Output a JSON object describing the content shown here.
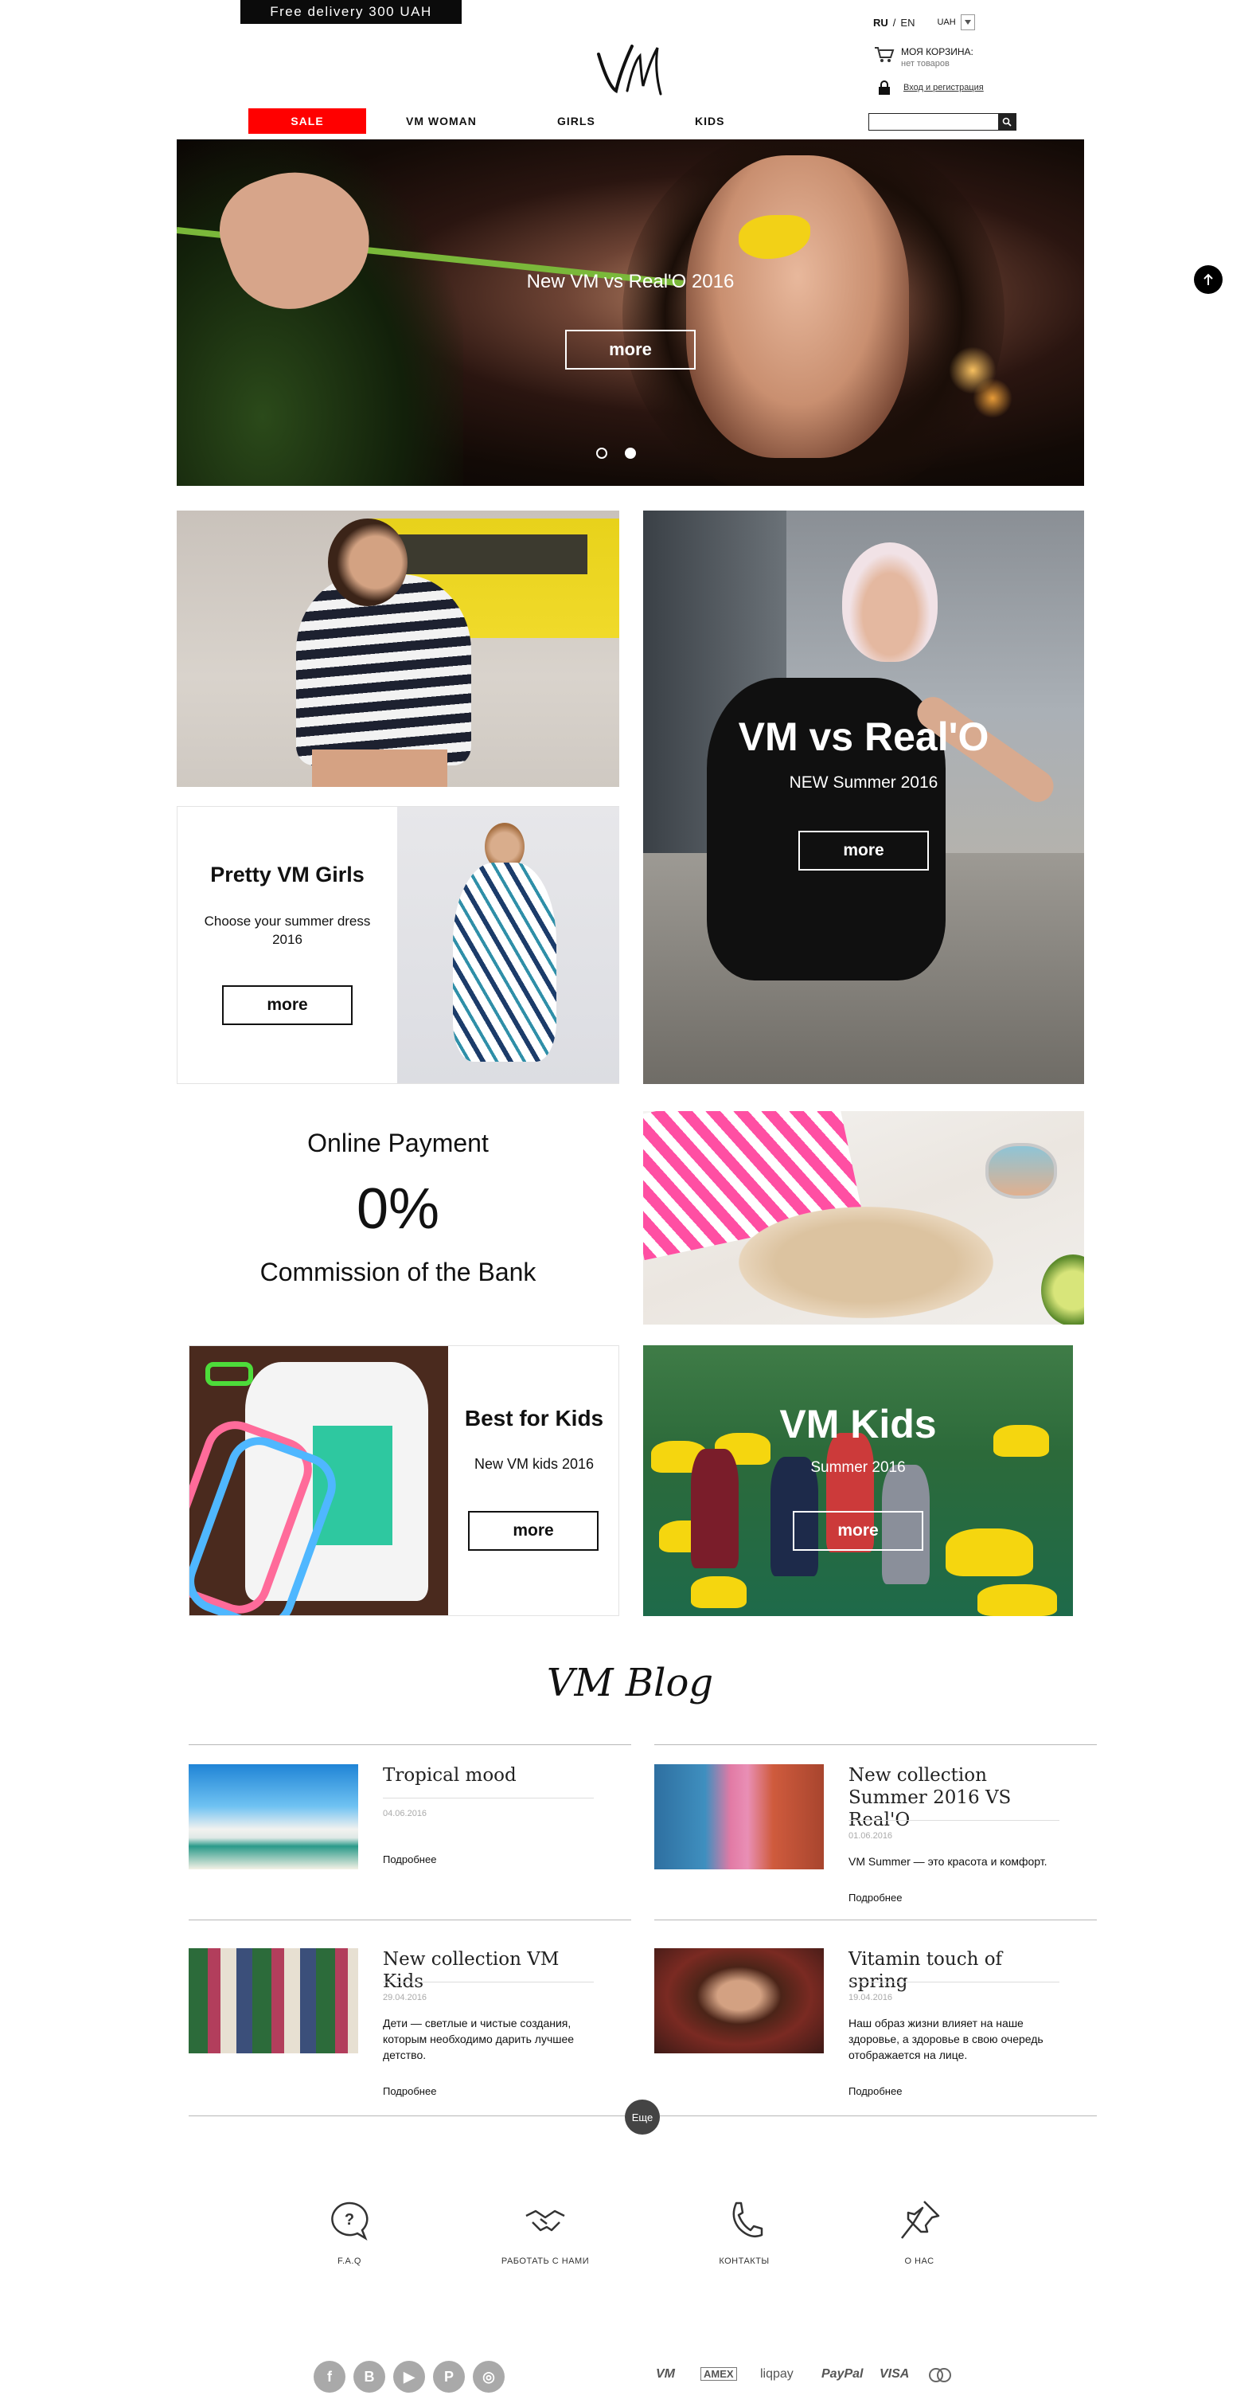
{
  "header": {
    "delivery_banner": "Free delivery 300 UAH",
    "lang_ru": "RU",
    "lang_sep": "/",
    "lang_en": "EN",
    "currency": "UAH",
    "cart_title": "МОЯ КОРЗИНА:",
    "cart_status": "нет товаров",
    "login_link": "Вход и регистрация",
    "search_placeholder": ""
  },
  "nav": {
    "items": [
      {
        "label": "SALE"
      },
      {
        "label": "VM WOMAN"
      },
      {
        "label": "GIRLS"
      },
      {
        "label": "KIDS"
      }
    ]
  },
  "hero": {
    "title": "New VM vs Real'O 2016",
    "button": "more",
    "slide_count": 2,
    "active_slide": 2
  },
  "promo": {
    "pretty": {
      "title": "Pretty VM Girls",
      "subtitle": "Choose your summer dress 2016",
      "button": "more"
    },
    "realo": {
      "title": "VM vs Real'O",
      "subtitle": "NEW Summer 2016",
      "button": "more"
    },
    "payment": {
      "line1": "Online Payment",
      "line2": "0%",
      "line3": "Commission of the Bank"
    },
    "best_kids": {
      "title": "Best for Kids",
      "subtitle": "New VM kids 2016",
      "button": "more"
    },
    "vm_kids": {
      "title": "VM Kids",
      "subtitle": "Summer 2016",
      "button": "more"
    }
  },
  "blog": {
    "title": "VM Blog",
    "posts": [
      {
        "title": "Tropical mood",
        "date": "04.06.2016",
        "text": "",
        "link": "Подробнее"
      },
      {
        "title": "New collection Summer 2016 VS Real'O",
        "date": "01.06.2016",
        "text": "VM Summer — это красота и комфорт.",
        "link": "Подробнее"
      },
      {
        "title": "New collection VM Kids",
        "date": "29.04.2016",
        "text": "Дети — светлые и чистые создания, которым необходимо дарить лучшее детство.",
        "link": "Подробнее"
      },
      {
        "title": "Vitamin touch of spring",
        "date": "19.04.2016",
        "text": "Наш образ жизни влияет на наше здоровье, а здоровье в свою очередь отображается на лице.",
        "link": "Подробнее"
      }
    ],
    "more_button": "Еще"
  },
  "footer": {
    "links": [
      {
        "label": "F.A.Q",
        "icon": "faq-icon"
      },
      {
        "label": "РАБОТАТЬ С НАМИ",
        "icon": "handshake-icon"
      },
      {
        "label": "КОНТАКТЫ",
        "icon": "phone-icon"
      },
      {
        "label": "О НАС",
        "icon": "pin-icon"
      }
    ],
    "social": [
      {
        "label": "f",
        "icon": "facebook-icon"
      },
      {
        "label": "B",
        "icon": "vkontakte-icon"
      },
      {
        "label": "▶",
        "icon": "youtube-icon"
      },
      {
        "label": "P",
        "icon": "pinterest-icon"
      },
      {
        "label": "◎",
        "icon": "instagram-icon"
      }
    ],
    "payments": [
      {
        "label": "VM",
        "icon": "vm-logo"
      },
      {
        "label": "AMEX",
        "icon": "amex-icon"
      },
      {
        "label": "liqpay",
        "icon": "liqpay-icon"
      },
      {
        "label": "PayPal",
        "icon": "paypal-icon"
      },
      {
        "label": "VISA",
        "icon": "visa-icon"
      },
      {
        "label": "",
        "icon": "mastercard-icon"
      }
    ]
  },
  "colors": {
    "sale_red": "#ff0000",
    "dark": "#0b0b0b",
    "social_grey": "#a9a9a9"
  }
}
